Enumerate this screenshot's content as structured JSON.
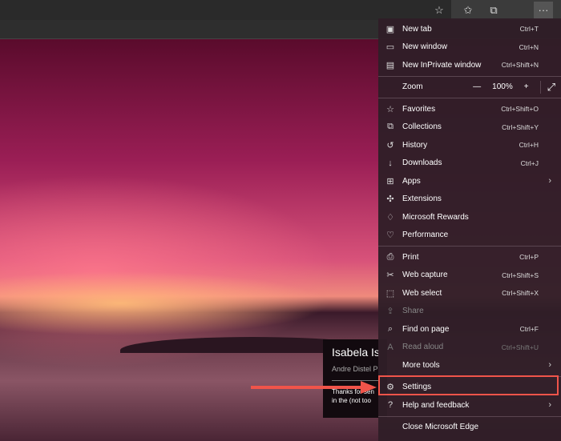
{
  "toolbar": {
    "icons": [
      "favorite-add-icon",
      "favorites-icon",
      "collections-icon",
      "more-icon"
    ],
    "more_label": "···"
  },
  "card": {
    "title": "Isabela Is",
    "author": "Andre Distel P",
    "body1": "Thanks for sen",
    "body2": "in the (not too"
  },
  "menu": {
    "items": [
      {
        "icon": "new-tab-icon",
        "glyph": "▣",
        "label": "New tab",
        "shortcut": "Ctrl+T"
      },
      {
        "icon": "new-window-icon",
        "glyph": "▭",
        "label": "New window",
        "shortcut": "Ctrl+N"
      },
      {
        "icon": "inprivate-icon",
        "glyph": "▤",
        "label": "New InPrivate window",
        "shortcut": "Ctrl+Shift+N"
      },
      {
        "label": "Zoom",
        "value": "100%",
        "minus": "—",
        "plus": "+",
        "expand": "⤢"
      },
      {
        "icon": "favorites-icon",
        "glyph": "☆",
        "label": "Favorites",
        "shortcut": "Ctrl+Shift+O"
      },
      {
        "icon": "collections-icon",
        "glyph": "⧉",
        "label": "Collections",
        "shortcut": "Ctrl+Shift+Y"
      },
      {
        "icon": "history-icon",
        "glyph": "↺",
        "label": "History",
        "shortcut": "Ctrl+H"
      },
      {
        "icon": "downloads-icon",
        "glyph": "↓",
        "label": "Downloads",
        "shortcut": "Ctrl+J"
      },
      {
        "icon": "apps-icon",
        "glyph": "⊞",
        "label": "Apps"
      },
      {
        "icon": "extensions-icon",
        "glyph": "✣",
        "label": "Extensions"
      },
      {
        "icon": "rewards-icon",
        "glyph": "♢",
        "label": "Microsoft Rewards"
      },
      {
        "icon": "performance-icon",
        "glyph": "♡",
        "label": "Performance"
      },
      {
        "icon": "print-icon",
        "glyph": "⎙",
        "label": "Print",
        "shortcut": "Ctrl+P"
      },
      {
        "icon": "web-capture-icon",
        "glyph": "✂",
        "label": "Web capture",
        "shortcut": "Ctrl+Shift+S"
      },
      {
        "icon": "web-select-icon",
        "glyph": "⬚",
        "label": "Web select",
        "shortcut": "Ctrl+Shift+X"
      },
      {
        "icon": "share-icon",
        "glyph": "⇪",
        "label": "Share"
      },
      {
        "icon": "find-icon",
        "glyph": "⌕",
        "label": "Find on page",
        "shortcut": "Ctrl+F"
      },
      {
        "icon": "read-aloud-icon",
        "glyph": "A",
        "label": "Read aloud",
        "shortcut": "Ctrl+Shift+U"
      },
      {
        "label": "More tools"
      },
      {
        "icon": "gear-icon",
        "glyph": "⚙",
        "label": "Settings"
      },
      {
        "icon": "help-icon",
        "glyph": "?",
        "label": "Help and feedback"
      },
      {
        "label": "Close Microsoft Edge"
      }
    ],
    "chevron": "›"
  },
  "colors": {
    "highlight": "#f0544a"
  }
}
